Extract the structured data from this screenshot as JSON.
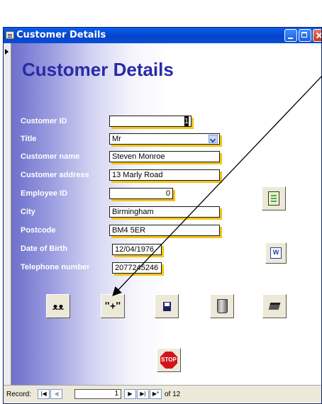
{
  "window": {
    "title": "Customer Details"
  },
  "form": {
    "heading": "Customer Details",
    "fields": {
      "customer_id": {
        "label": "Customer ID",
        "value": "1"
      },
      "title": {
        "label": "Title",
        "value": "Mr"
      },
      "customer_name": {
        "label": "Customer name",
        "value": "Steven Monroe"
      },
      "customer_address": {
        "label": "Customer address",
        "value": "13 Marly Road"
      },
      "employee_id": {
        "label": "Employee ID",
        "value": "0"
      },
      "city": {
        "label": "City",
        "value": "Birmingham"
      },
      "postcode": {
        "label": "Postcode",
        "value": "BM4 5ER"
      },
      "date_of_birth": {
        "label": "Date of Birth",
        "value": "12/04/1976"
      },
      "telephone": {
        "label": "Telephone number",
        "value": "2077245246"
      }
    },
    "buttons": {
      "new_record_symbol": "\"+\"",
      "stop_label": "STOP",
      "word_label": "W"
    }
  },
  "navigation": {
    "record_label": "Record:",
    "current_record": "1",
    "total_text": "of 12"
  },
  "colors": {
    "heading": "#2a2aa6",
    "field_shadow": "#f2c418",
    "gradient_left": "#6d6fcb",
    "titlebar": "#0a5ff0",
    "stop": "#d2141a"
  }
}
